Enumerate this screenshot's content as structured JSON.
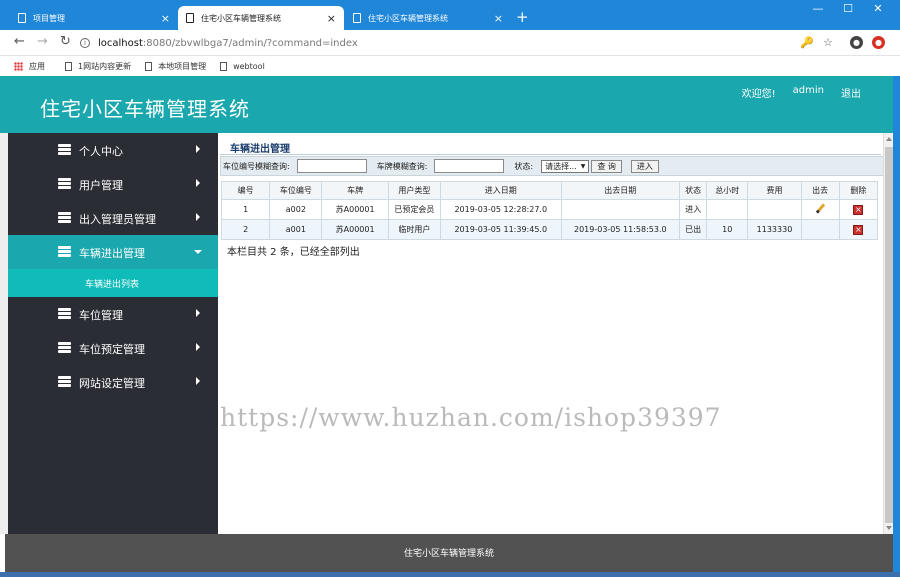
{
  "browser": {
    "tabs": [
      {
        "title": "项目管理",
        "close": "×"
      },
      {
        "title": "住宅小区车辆管理系统",
        "close": "×"
      },
      {
        "title": "住宅小区车辆管理系统",
        "close": "×"
      }
    ],
    "new_tab": "+",
    "window_controls": {
      "minimize": "—",
      "maximize": "☐",
      "close": "✕"
    },
    "nav": {
      "back": "←",
      "forward": "→",
      "reload": "↻"
    },
    "url": {
      "host": "localhost",
      "path": ":8080/zbvwlbga7/admin/?command=index",
      "info": "i"
    },
    "icons": {
      "key": "🔑",
      "star": "☆"
    },
    "bookmarks": [
      {
        "label": "应用",
        "icon": "apps-icon"
      },
      {
        "label": "1网站内容更新",
        "icon": "page-icon"
      },
      {
        "label": "本地项目管理",
        "icon": "page-icon"
      },
      {
        "label": "webtool",
        "icon": "page-icon"
      }
    ]
  },
  "header": {
    "title": "住宅小区车辆管理系统",
    "welcome": "欢迎您!",
    "username": "admin",
    "logout": "退出",
    "color": "#1aa7ad"
  },
  "sidebar": {
    "items": [
      {
        "label": "个人中心",
        "active": false
      },
      {
        "label": "用户管理",
        "active": false
      },
      {
        "label": "出入管理员管理",
        "active": false
      },
      {
        "label": "车辆进出管理",
        "active": true
      },
      {
        "label": "车位管理",
        "active": false
      },
      {
        "label": "车位预定管理",
        "active": false
      },
      {
        "label": "网站设定管理",
        "active": false
      }
    ],
    "submenu": {
      "label": "车辆进出列表"
    }
  },
  "main": {
    "section_title": "车辆进出管理",
    "filters": {
      "spot_label": "车位编号模糊查询:",
      "spot_value": "",
      "plate_label": "车牌模糊查询:",
      "plate_value": "",
      "status_label": "状态:",
      "status_selected": "请选择...",
      "search_button": "查 询",
      "enter_button": "进入"
    },
    "table": {
      "headers": [
        "编号",
        "车位编号",
        "车牌",
        "用户类型",
        "进入日期",
        "出去日期",
        "状态",
        "总小时",
        "费用",
        "出去",
        "删除"
      ],
      "rows": [
        {
          "id": "1",
          "spot": "a002",
          "plate": "苏A00001",
          "user_type": "已预定会员",
          "enter_time": "2019-03-05 12:28:27.0",
          "exit_time": "",
          "status": "进入",
          "hours": "",
          "fee": ""
        },
        {
          "id": "2",
          "spot": "a001",
          "plate": "苏A00001",
          "user_type": "临时用户",
          "enter_time": "2019-03-05 11:39:45.0",
          "exit_time": "2019-03-05 11:58:53.0",
          "status": "已出",
          "hours": "10",
          "fee": "1133330"
        }
      ]
    },
    "summary": "本栏目共 2 条，已经全部列出"
  },
  "watermark": "https://www.huzhan.com/ishop39397",
  "footer": {
    "text": "住宅小区车辆管理系统"
  }
}
